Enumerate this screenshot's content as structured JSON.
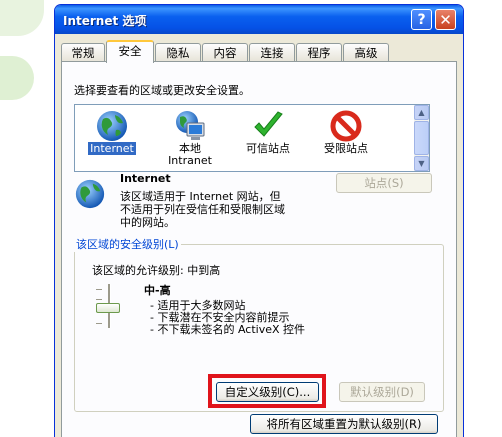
{
  "window": {
    "title": "Internet 选项",
    "help_symbol": "?",
    "close_symbol": "✕"
  },
  "tabs": [
    "常规",
    "安全",
    "隐私",
    "内容",
    "连接",
    "程序",
    "高级"
  ],
  "active_tab": "安全",
  "security": {
    "instruction": "选择要查看的区域或更改安全设置。",
    "zones": [
      {
        "label": "Internet",
        "icon": "globe-icon",
        "selected": true
      },
      {
        "label": "本地\nIntranet",
        "icon": "computer-globe-icon",
        "selected": false
      },
      {
        "label": "可信站点",
        "icon": "checkmark-icon",
        "selected": false
      },
      {
        "label": "受限站点",
        "icon": "no-entry-icon",
        "selected": false
      }
    ],
    "zone_info": {
      "title": "Internet",
      "description": [
        "该区域适用于 Internet 网站，但",
        "不适用于列在受信任和受限制区域",
        "中的网站。"
      ],
      "sites_button": "站点(S)"
    },
    "level_group": {
      "title": "该区域的安全级别(L)",
      "allowed_levels": "该区域的允许级别: 中到高",
      "level_name": "中-高",
      "bullets": [
        "- 适用于大多数网站",
        "- 下载潜在不安全内容前提示",
        "- 不下载未签名的 ActiveX 控件"
      ],
      "custom_button": "自定义级别(C)...",
      "default_button": "默认级别(D)"
    },
    "reset_all_button": "将所有区域重置为默认级别(R)"
  },
  "colors": {
    "titlebar": "#0a5ce6",
    "dialog_bg": "#ece9d8",
    "selection": "#316ac5",
    "group_title": "#0046d5",
    "highlight": "#e0141b"
  }
}
